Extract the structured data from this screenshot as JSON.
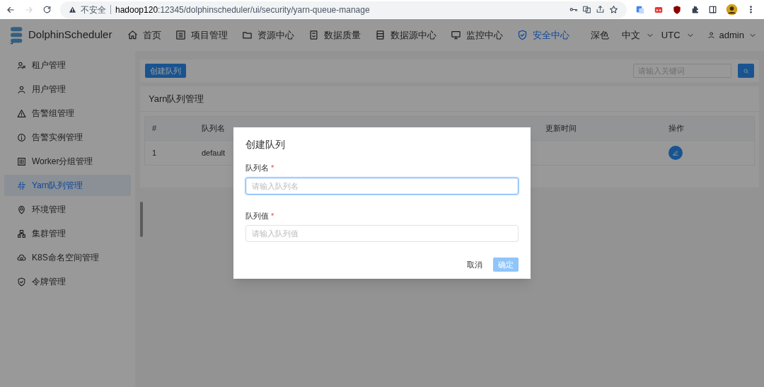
{
  "browser": {
    "security_label": "不安全",
    "url_host": "hadoop120",
    "url_rest": ":12345/dolphinscheduler/ui/security/yarn-queue-manage"
  },
  "app": {
    "logo_text": "DolphinScheduler",
    "nav": [
      {
        "label": "首页",
        "selected": false
      },
      {
        "label": "项目管理",
        "selected": false
      },
      {
        "label": "资源中心",
        "selected": false
      },
      {
        "label": "数据质量",
        "selected": false
      },
      {
        "label": "数据源中心",
        "selected": false
      },
      {
        "label": "监控中心",
        "selected": false
      },
      {
        "label": "安全中心",
        "selected": true
      }
    ],
    "theme": "深色",
    "language": "中文",
    "timezone": "UTC",
    "user": "admin"
  },
  "sidebar": {
    "items": [
      {
        "label": "租户管理",
        "selected": false
      },
      {
        "label": "用户管理",
        "selected": false
      },
      {
        "label": "告警组管理",
        "selected": false
      },
      {
        "label": "告警实例管理",
        "selected": false
      },
      {
        "label": "Worker分组管理",
        "selected": false
      },
      {
        "label": "Yarn队列管理",
        "selected": true
      },
      {
        "label": "环境管理",
        "selected": false
      },
      {
        "label": "集群管理",
        "selected": false
      },
      {
        "label": "K8S命名空间管理",
        "selected": false
      },
      {
        "label": "令牌管理",
        "selected": false
      }
    ]
  },
  "toolbar": {
    "create_button": "创建队列",
    "search": {
      "placeholder": "请输入关键词"
    }
  },
  "card": {
    "title": "Yarn队列管理",
    "table": {
      "columns": [
        "#",
        "队列名",
        "更新时间",
        "操作"
      ],
      "rows": [
        {
          "index": "1",
          "name": "default"
        }
      ]
    }
  },
  "dialog": {
    "title": "创建队列",
    "fields": [
      {
        "label": "队列名",
        "required_mark": "*",
        "placeholder": "请输入队列名",
        "focused": true
      },
      {
        "label": "队列值",
        "required_mark": "*",
        "placeholder": "请输入队列值",
        "focused": false
      }
    ],
    "cancel": "取消",
    "confirm": "确定",
    "confirm_disabled": true
  }
}
